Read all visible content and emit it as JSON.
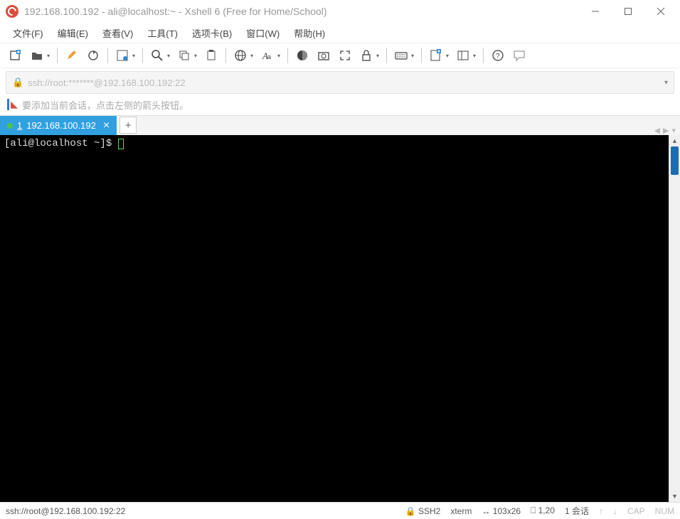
{
  "window": {
    "title": "192.168.100.192 - ali@localhost:~ - Xshell 6 (Free for Home/School)"
  },
  "menu": {
    "file": "文件(F)",
    "edit": "编辑(E)",
    "view": "查看(V)",
    "tools": "工具(T)",
    "tabs": "选项卡(B)",
    "window": "窗口(W)",
    "help": "帮助(H)"
  },
  "address": {
    "url": "ssh://root:*******@192.168.100.192:22"
  },
  "hint": {
    "text": "要添加当前会话，点击左侧的箭头按钮。"
  },
  "tab": {
    "num": "1",
    "label": "192.168.100.192",
    "add": "+"
  },
  "terminal": {
    "prompt": "[ali@localhost ~]$ "
  },
  "status": {
    "left": "ssh://root@192.168.100.192:22",
    "ssh": "SSH2",
    "term": "xterm",
    "size": "103x26",
    "rows": "1,20",
    "sess": "1 会话",
    "cap": "CAP",
    "num": "NUM"
  }
}
